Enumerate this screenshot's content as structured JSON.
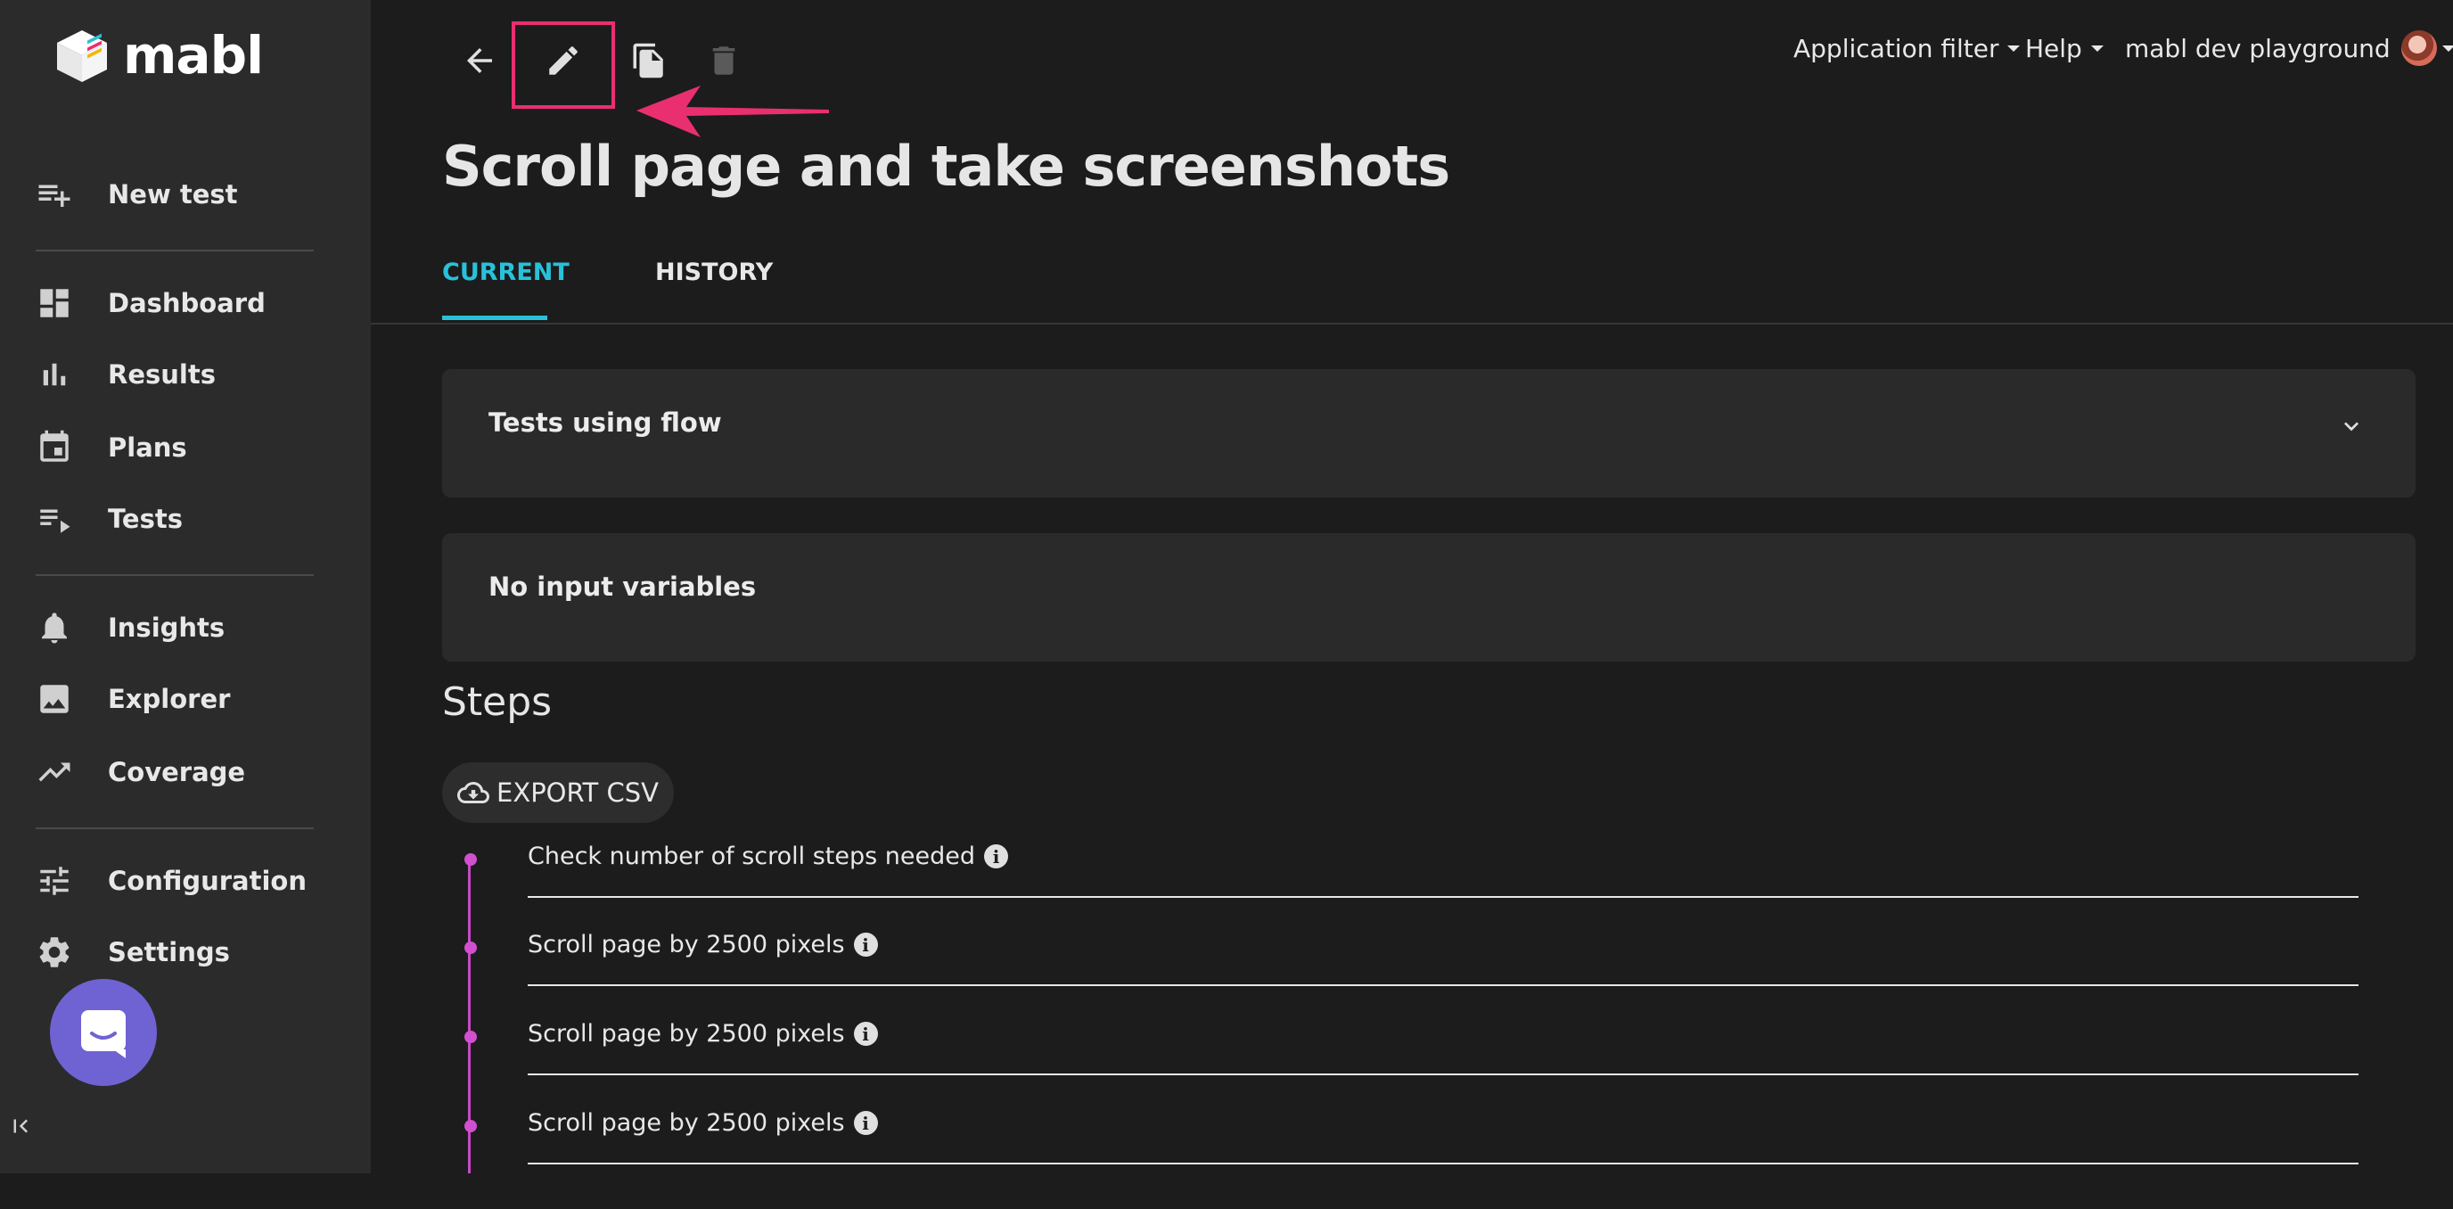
{
  "app": {
    "name": "mabl"
  },
  "sidebar": {
    "items": [
      {
        "label": "New test",
        "icon": "playlist-add-icon"
      },
      {
        "label": "Dashboard",
        "icon": "dashboard-icon"
      },
      {
        "label": "Results",
        "icon": "bar-chart-icon"
      },
      {
        "label": "Plans",
        "icon": "calendar-icon"
      },
      {
        "label": "Tests",
        "icon": "playlist-play-icon"
      },
      {
        "label": "Insights",
        "icon": "bell-icon"
      },
      {
        "label": "Explorer",
        "icon": "image-icon"
      },
      {
        "label": "Coverage",
        "icon": "trending-up-icon"
      },
      {
        "label": "Configuration",
        "icon": "tune-icon"
      },
      {
        "label": "Settings",
        "icon": "gear-icon"
      }
    ]
  },
  "header": {
    "application_filter": "Application filter",
    "help": "Help",
    "workspace": "mabl dev playground"
  },
  "page": {
    "title": "Scroll page and take screenshots",
    "tabs": [
      {
        "label": "CURRENT",
        "active": true
      },
      {
        "label": "HISTORY",
        "active": false
      }
    ],
    "panels": {
      "tests_using_flow": "Tests using flow",
      "input_variables": "No input variables"
    },
    "steps_title": "Steps",
    "export_label": "EXPORT CSV",
    "steps": [
      "Check number of scroll steps needed",
      "Scroll page by 2500 pixels",
      "Scroll page by 2500 pixels",
      "Scroll page by 2500 pixels"
    ]
  },
  "colors": {
    "accent": "#29c1d9",
    "highlight": "#ea2f71",
    "timeline": "#c849c6",
    "chat": "#6f63d3"
  }
}
